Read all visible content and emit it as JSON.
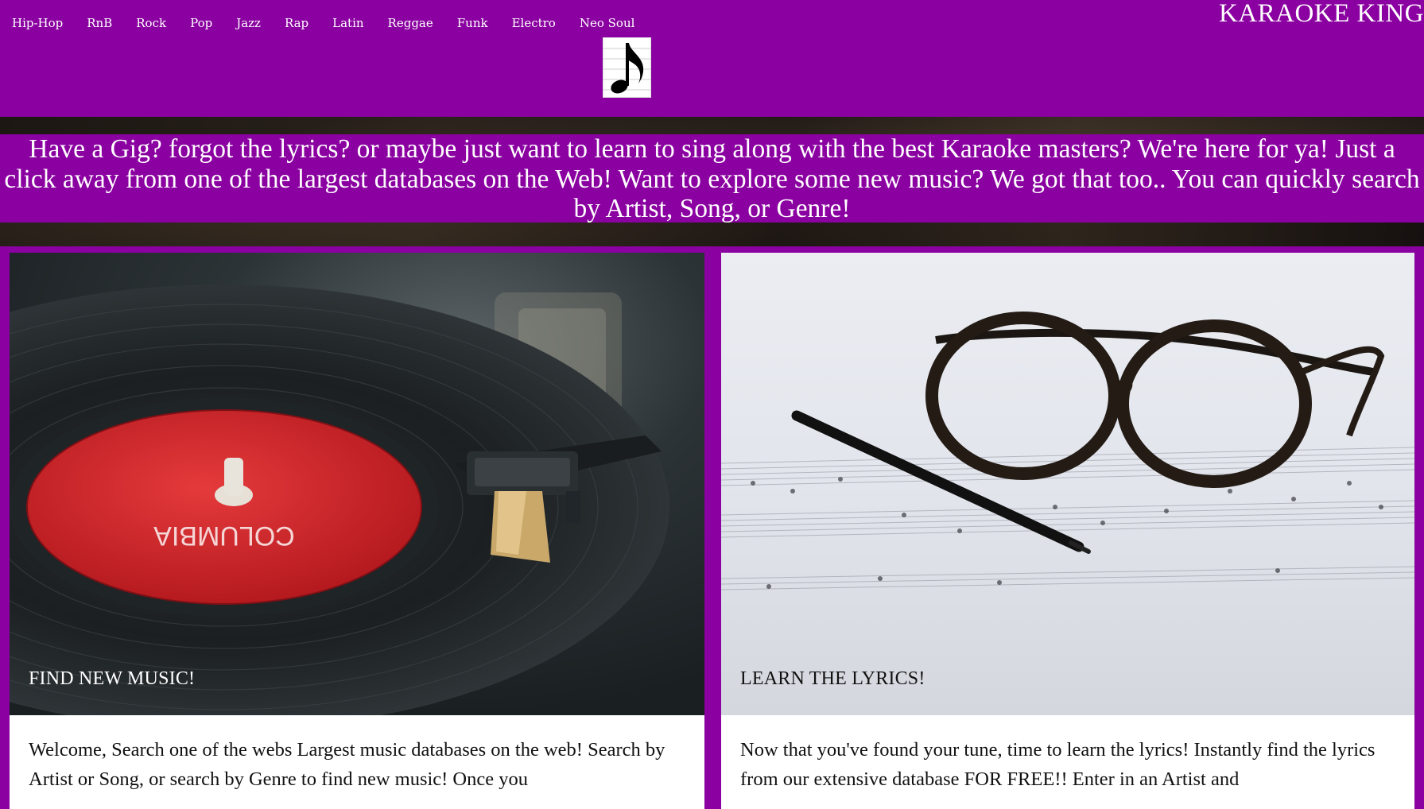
{
  "nav": {
    "genres": [
      "Hip-Hop",
      "RnB",
      "Rock",
      "Pop",
      "Jazz",
      "Rap",
      "Latin",
      "Reggae",
      "Funk",
      "Electro",
      "Neo Soul"
    ]
  },
  "brand": "KARAOKE KING",
  "logo_icon": "music-note-icon",
  "hero": {
    "text": "Have a Gig? forgot the lyrics? or maybe just want to learn to sing along with the best Karaoke masters? We're here for ya! Just a click away from one of the largest databases on the Web! Want to explore some new music? We got that too.. You can quickly search by Artist, Song, or Genre!"
  },
  "cards": [
    {
      "image": "vinyl-record-turntable",
      "image_label": "COLUMBIA",
      "caption": "FIND NEW MUSIC!",
      "body": "Welcome, Search one of the webs Largest music databases on the web! Search by Artist or Song, or search by Genre to find new music! Once you"
    },
    {
      "image": "glasses-on-sheet-music",
      "caption": "LEARN THE LYRICS!",
      "body": "Now that you've found your tune, time to learn the lyrics! Instantly find the lyrics from our extensive database FOR FREE!! Enter in an Artist and"
    }
  ],
  "colors": {
    "brand_purple": "#8a00a0",
    "text_light": "#ffffff",
    "text_dark": "#111111"
  }
}
